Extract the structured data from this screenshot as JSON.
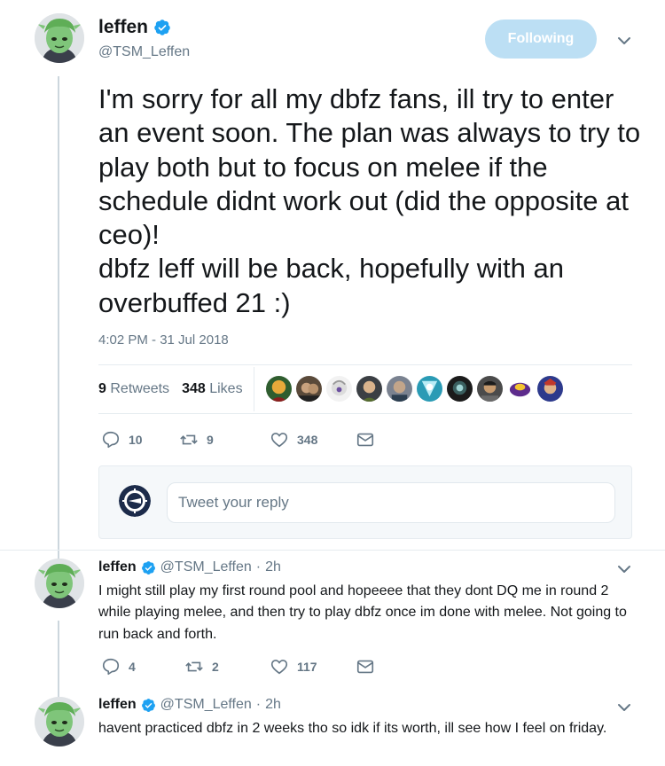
{
  "main_tweet": {
    "name": "leffen",
    "handle": "@TSM_Leffen",
    "follow_label": "Following",
    "text": "I'm sorry for all my dbfz fans, ill try to enter an event soon. The plan was always to try to play both but to focus on melee if the schedule didnt work out (did the opposite at ceo)!\ndbfz leff will be back, hopefully with an overbuffed 21 :)",
    "timestamp": "4:02 PM - 31 Jul 2018",
    "retweets_count": "9",
    "retweets_label": "Retweets",
    "likes_count": "348",
    "likes_label": "Likes",
    "actions": {
      "replies": "10",
      "retweets": "9",
      "likes": "348"
    }
  },
  "reply_box": {
    "placeholder": "Tweet your reply"
  },
  "replies": [
    {
      "name": "leffen",
      "handle": "@TSM_Leffen",
      "time": "2h",
      "text": "I might still play my first round pool and hopeeee that they dont DQ me in round 2 while playing melee, and then try to play dbfz once im done with melee.  Not going to run back and forth.",
      "actions": {
        "replies": "4",
        "retweets": "2",
        "likes": "117"
      }
    },
    {
      "name": "leffen",
      "handle": "@TSM_Leffen",
      "time": "2h",
      "text": "havent practiced dbfz in 2 weeks tho so idk if its worth, ill see how I feel on friday."
    }
  ],
  "colors": {
    "verified_blue": "#1da1f2",
    "following_button": "#bcdff4",
    "secondary_text": "#657786",
    "thread_line": "#ccd6dd"
  },
  "icons": [
    "verified-badge-icon",
    "chevron-down-icon",
    "reply-icon",
    "retweet-icon",
    "like-icon",
    "message-icon"
  ]
}
